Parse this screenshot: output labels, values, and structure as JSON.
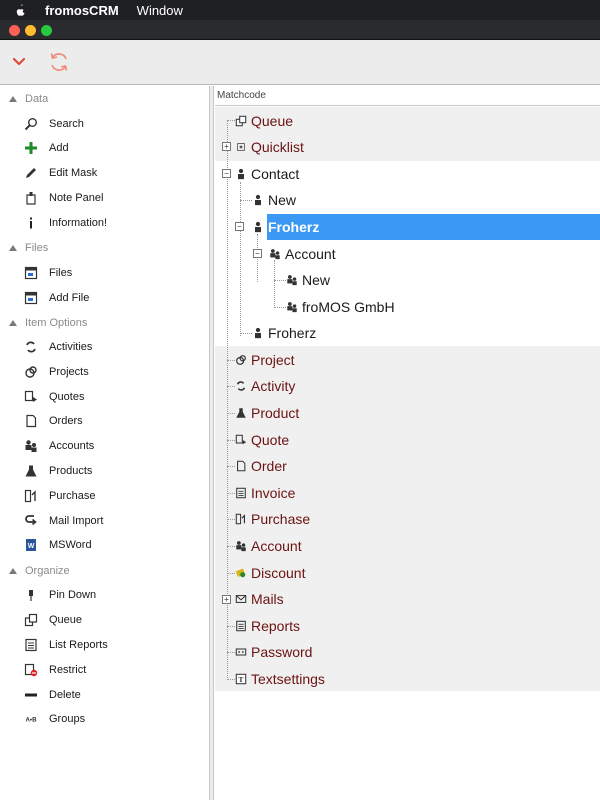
{
  "menubar": {
    "app_name": "fromosCRM",
    "menu_window": "Window"
  },
  "tree": {
    "header": "Matchcode"
  },
  "sidebar": {
    "sections": [
      {
        "label": "Data",
        "items": [
          {
            "label": "Search",
            "icon": "search-icon"
          },
          {
            "label": "Add",
            "icon": "plus-icon"
          },
          {
            "label": "Edit Mask",
            "icon": "pencil-icon"
          },
          {
            "label": "Note Panel",
            "icon": "note-icon"
          },
          {
            "label": "Information!",
            "icon": "info-icon"
          }
        ]
      },
      {
        "label": "Files",
        "items": [
          {
            "label": "Files",
            "icon": "files-icon"
          },
          {
            "label": "Add File",
            "icon": "add-file-icon"
          }
        ]
      },
      {
        "label": "Item Options",
        "items": [
          {
            "label": "Activities",
            "icon": "activities-icon"
          },
          {
            "label": "Projects",
            "icon": "projects-icon"
          },
          {
            "label": "Quotes",
            "icon": "quotes-icon"
          },
          {
            "label": "Orders",
            "icon": "orders-icon"
          },
          {
            "label": "Accounts",
            "icon": "accounts-icon"
          },
          {
            "label": "Products",
            "icon": "flask-icon"
          },
          {
            "label": "Purchase",
            "icon": "purchase-icon"
          },
          {
            "label": "Mail Import",
            "icon": "mail-import-icon"
          },
          {
            "label": "MSWord",
            "icon": "word-icon"
          }
        ]
      },
      {
        "label": "Organize",
        "items": [
          {
            "label": "Pin Down",
            "icon": "pin-icon"
          },
          {
            "label": "Queue",
            "icon": "queue-icon"
          },
          {
            "label": "List Reports",
            "icon": "reports-icon"
          },
          {
            "label": "Restrict",
            "icon": "restrict-icon"
          },
          {
            "label": "Delete",
            "icon": "delete-icon"
          },
          {
            "label": "Groups",
            "icon": "groups-icon"
          }
        ]
      }
    ]
  },
  "tree_nodes": [
    {
      "label": "Queue",
      "icon": "queue-icon"
    },
    {
      "label": "Quicklist",
      "icon": "quicklist-icon"
    },
    {
      "label": "Contact",
      "icon": "person-icon"
    },
    {
      "label": "New",
      "icon": "person-icon"
    },
    {
      "label": "Froherz",
      "icon": "person-icon"
    },
    {
      "label": "Account",
      "icon": "accounts-icon"
    },
    {
      "label": "New",
      "icon": "accounts-icon"
    },
    {
      "label": "froMOS GmbH",
      "icon": "accounts-icon"
    },
    {
      "label": "Froherz",
      "icon": "person-icon"
    },
    {
      "label": "Project",
      "icon": "projects-icon"
    },
    {
      "label": "Activity",
      "icon": "activities-icon"
    },
    {
      "label": "Product",
      "icon": "flask-icon"
    },
    {
      "label": "Quote",
      "icon": "quotes-icon"
    },
    {
      "label": "Order",
      "icon": "orders-icon"
    },
    {
      "label": "Invoice",
      "icon": "invoice-icon"
    },
    {
      "label": "Purchase",
      "icon": "purchase-icon"
    },
    {
      "label": "Account",
      "icon": "accounts-icon"
    },
    {
      "label": "Discount",
      "icon": "discount-icon"
    },
    {
      "label": "Mails",
      "icon": "mail-icon"
    },
    {
      "label": "Reports",
      "icon": "reports-icon"
    },
    {
      "label": "Password",
      "icon": "password-icon"
    },
    {
      "label": "Textsettings",
      "icon": "text-icon"
    }
  ],
  "colors": {
    "selection": "#3b99f4",
    "tree_text": "#6b1212",
    "toolbar_icon": "#e04a3a"
  }
}
